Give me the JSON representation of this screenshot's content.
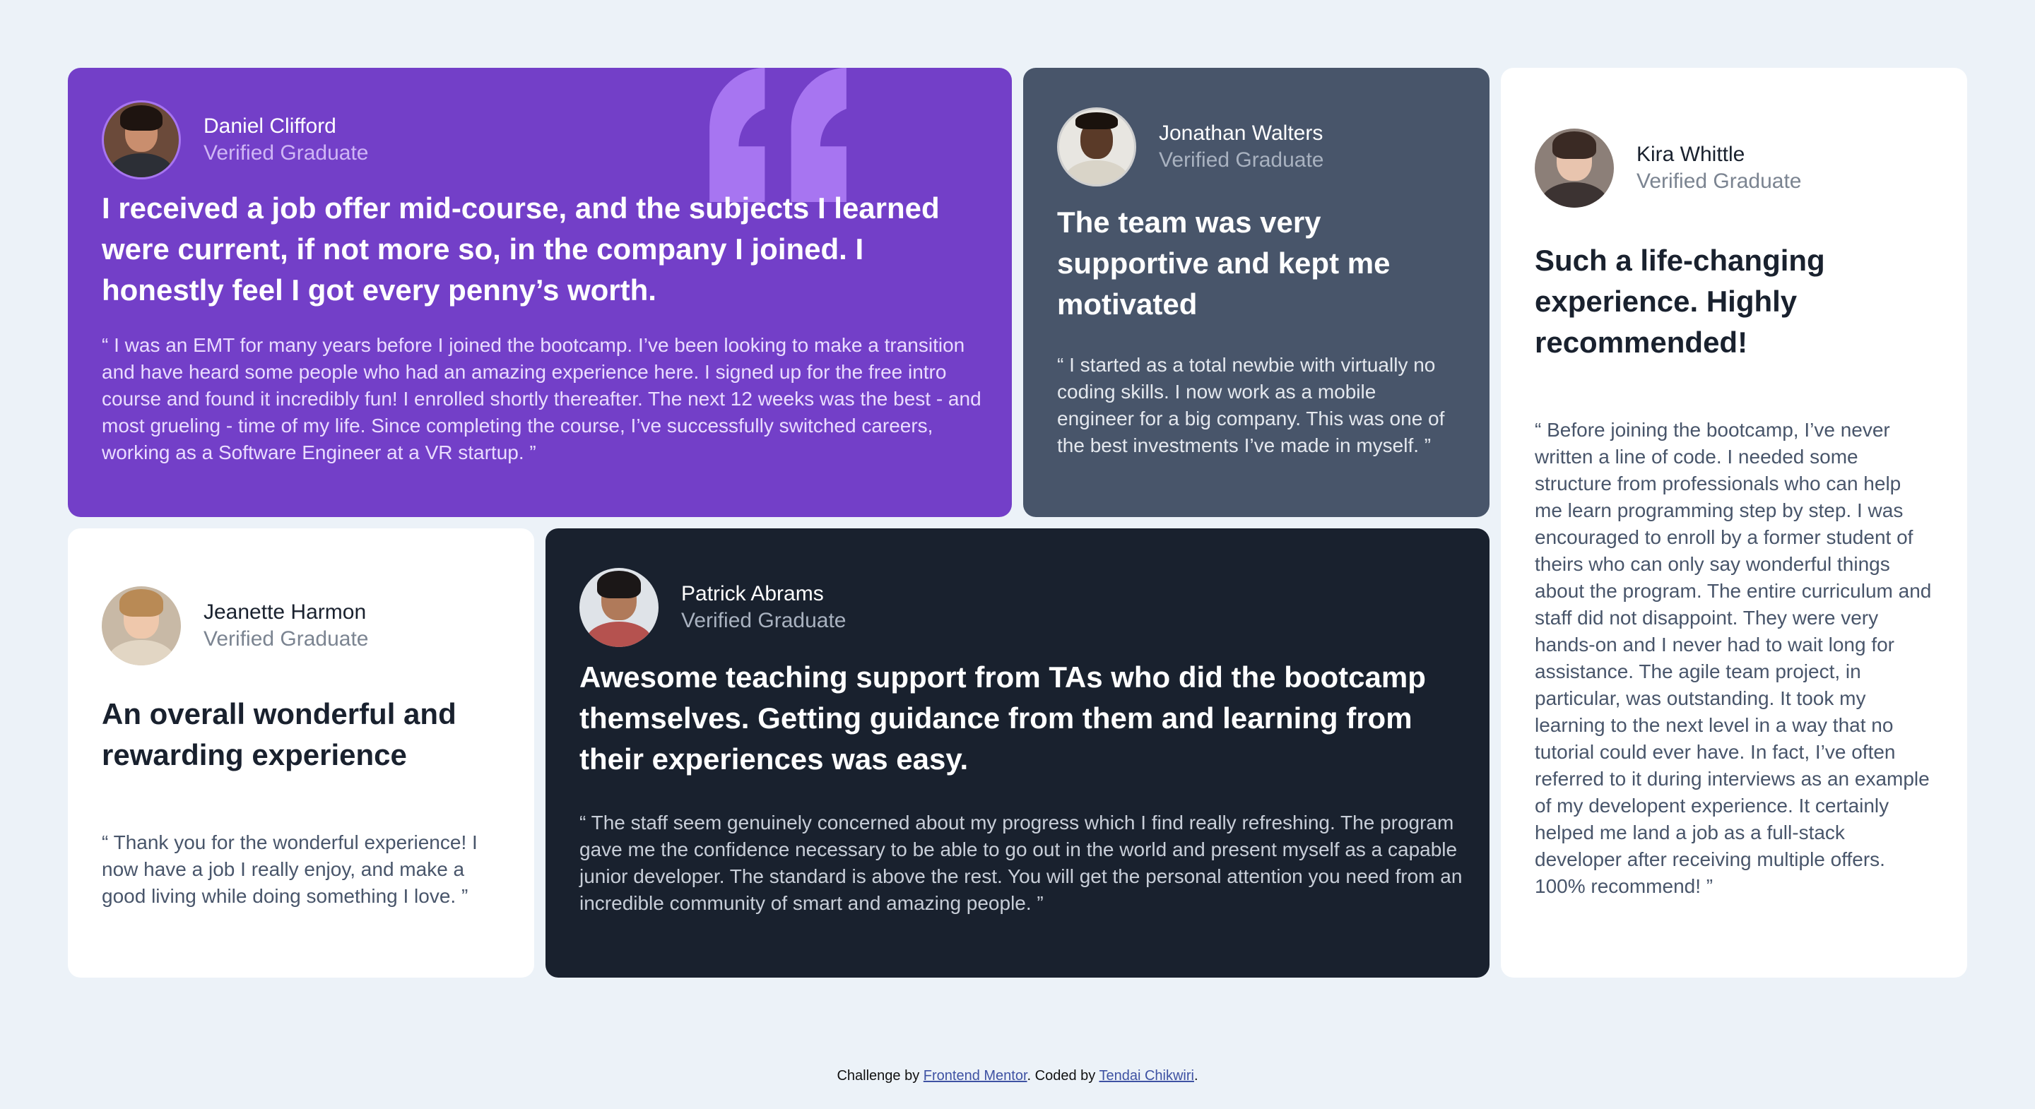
{
  "testimonials": [
    {
      "name": "Daniel Clifford",
      "role": "Verified Graduate",
      "headline": "I received a job offer mid-course, and the subjects I learned were current, if not more so, in the company I joined. I honestly feel I got every penny’s worth.",
      "body": "“ I was an EMT for many years before I joined the bootcamp. I’ve been looking to make a transition and have heard some people who had an amazing experience here. I signed up for the free intro course and found it incredibly fun! I enrolled shortly thereafter. The next 12 weeks was the best - and most grueling - time of my life. Since completing the course, I’ve successfully switched careers, working as a Software Engineer at a VR startup. ”"
    },
    {
      "name": "Jonathan Walters",
      "role": "Verified Graduate",
      "headline": "The team was very supportive and kept me motivated",
      "body": "“ I started as a total newbie with virtually no coding skills. I now work as a mobile engineer for a big company. This was one of the best investments I’ve made in myself. ”"
    },
    {
      "name": "Kira Whittle",
      "role": "Verified Graduate",
      "headline": "Such a life-changing experience. Highly recommended!",
      "body": "“ Before joining the bootcamp, I’ve never written a line of code. I needed some structure from professionals who can help me learn programming step by step. I was encouraged to enroll by a former student of theirs who can only say wonderful things about the program. The entire curriculum and staff did not disappoint. They were very hands-on and I never had to wait long for assistance. The agile team project, in particular, was outstanding. It took my learning to the next level in a way that no tutorial could ever have. In fact, I’ve often referred to it during interviews as an example of my developent experience. It certainly helped me land a job as a full-stack developer after receiving multiple offers. 100% recommend! ”"
    },
    {
      "name": "Jeanette Harmon",
      "role": "Verified Graduate",
      "headline": "An overall wonderful and rewarding experience",
      "body": "“ Thank you for the wonderful experience! I now have a job I really enjoy, and make a good living while doing something I love. ”"
    },
    {
      "name": "Patrick Abrams",
      "role": "Verified Graduate",
      "headline": "Awesome teaching support from TAs who did the bootcamp themselves. Getting guidance from them and learning from their experiences was easy.",
      "body": "“ The staff seem genuinely concerned about my progress which I find really refreshing. The program gave me the confidence necessary to be able to go out in the world and present myself as a capable junior developer. The standard is above the rest. You will get the personal attention you need from an incredible community of smart and amazing people. ”"
    }
  ],
  "attribution": {
    "prefix": "Challenge by",
    "link1": "Frontend Mentor",
    "middle": ". Coded by",
    "link2": "Tendai Chikwiri",
    "suffix": "."
  },
  "colors": {
    "page_bg": "#ecf2f8",
    "moderate_violet": "#733fc8",
    "grayish_blue": "#48556a",
    "dark_blackish_blue": "#19212e",
    "white": "#ffffff"
  },
  "icons": {
    "quote": "quote-icon"
  }
}
